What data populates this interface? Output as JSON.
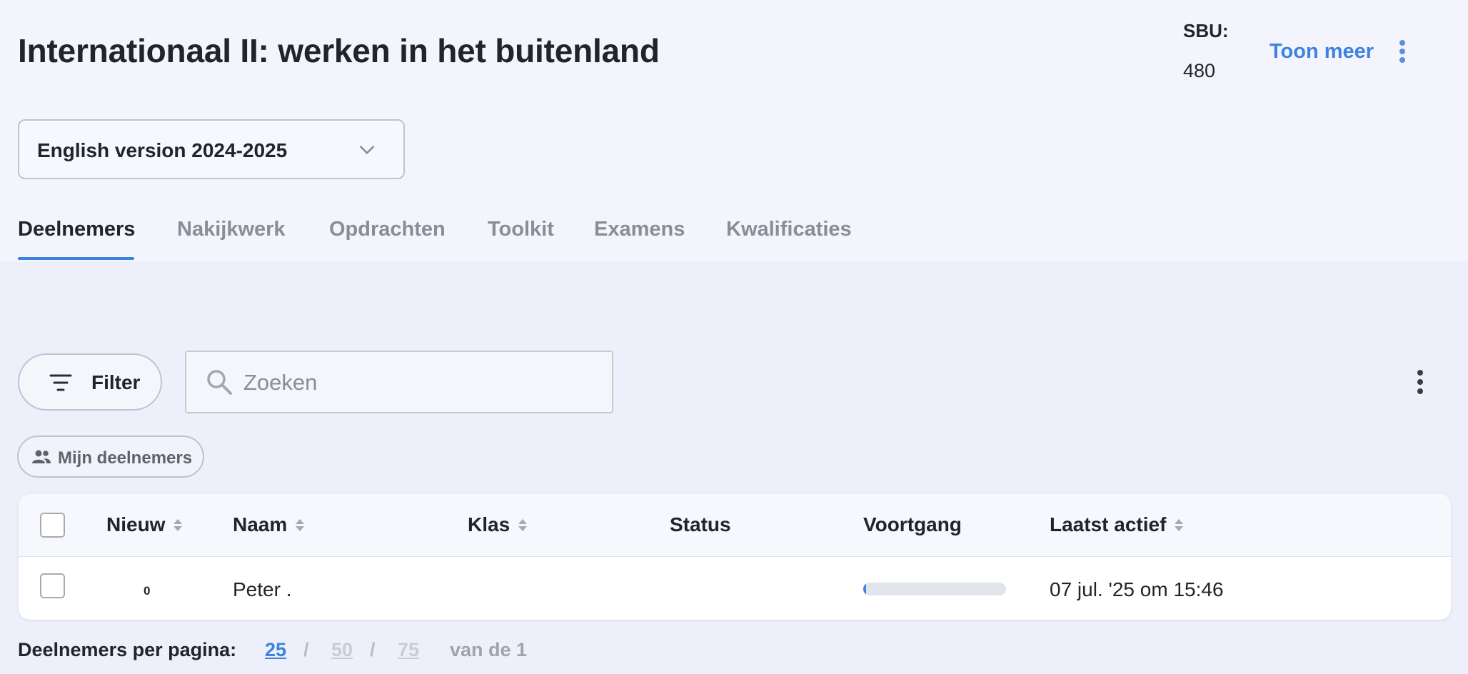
{
  "header": {
    "title": "Internationaal II: werken in het buitenland",
    "sbu_label": "SBU:",
    "sbu_value": "480",
    "toon_meer": "Toon meer",
    "more_icon": "vertical-dots-icon"
  },
  "version_select": {
    "value": "English version 2024-2025",
    "icon": "chevron-down-icon"
  },
  "tabs": [
    {
      "label": "Deelnemers",
      "active": true
    },
    {
      "label": "Nakijkwerk"
    },
    {
      "label": "Opdrachten"
    },
    {
      "label": "Toolkit"
    },
    {
      "label": "Examens"
    },
    {
      "label": "Kwalificaties"
    }
  ],
  "toolbar": {
    "filter_label": "Filter",
    "filter_icon": "filter-lines-icon",
    "search_placeholder": "Zoeken",
    "search_icon": "search-icon",
    "chip_label": "Mijn deelnemers",
    "chip_icon": "people-icon"
  },
  "table": {
    "columns": [
      "Nieuw",
      "Naam",
      "Klas",
      "Status",
      "Voortgang",
      "Laatst actief"
    ],
    "rows": [
      {
        "nieuw": "0",
        "naam": "Peter .",
        "klas": "",
        "status": "",
        "voortgang": 0.02,
        "laatst_actief": "07 jul. '25 om 15:46"
      }
    ]
  },
  "pagination": {
    "label": "Deelnemers per pagina:",
    "options": [
      "25",
      "50",
      "75"
    ],
    "selected": "25",
    "separator": "/",
    "total": "van de 1"
  },
  "colors": {
    "accent": "#3d82e0",
    "background_top": "#f4f5fc",
    "background_content": "#edf0fb"
  }
}
